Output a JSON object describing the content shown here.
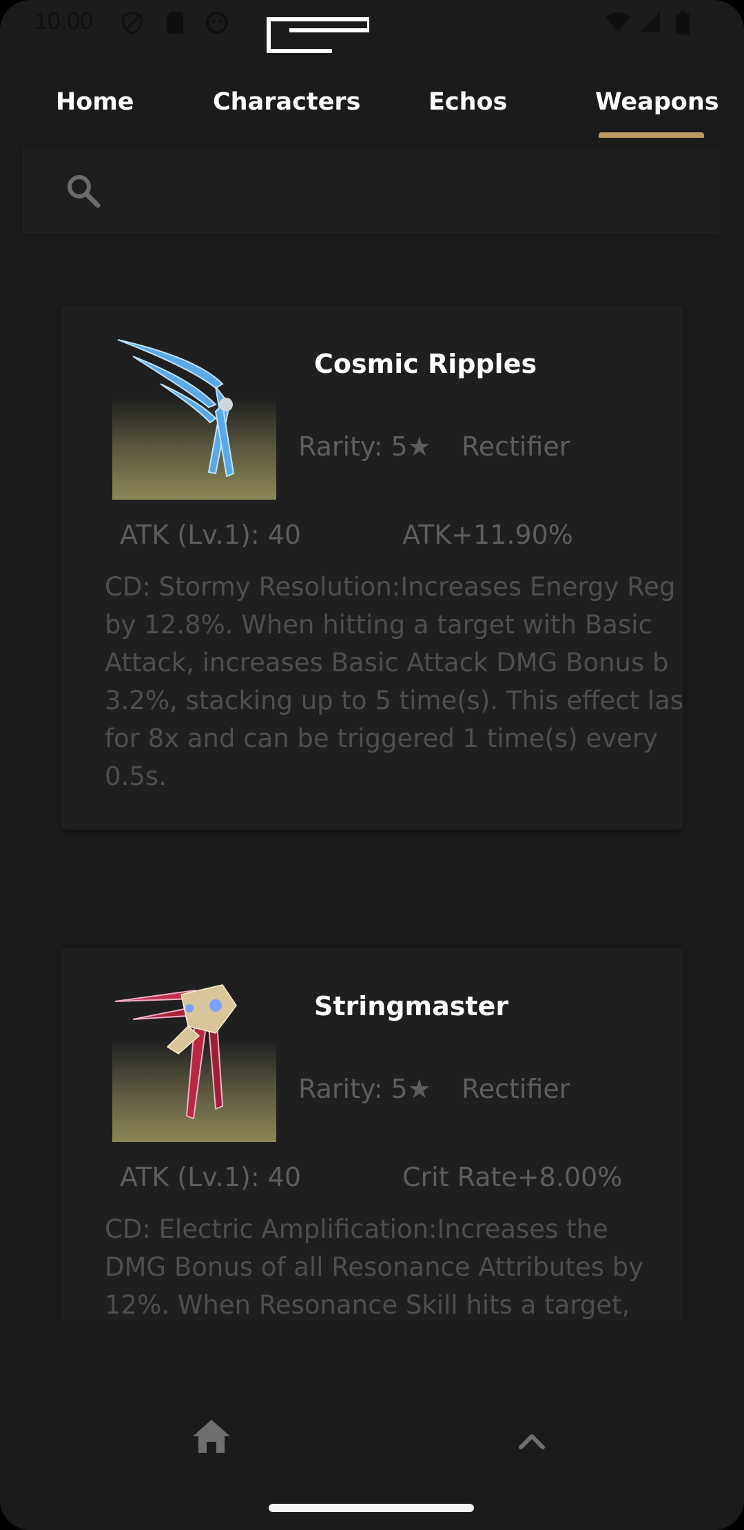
{
  "status_bar": {
    "time": "10:00",
    "icons": [
      "shield-icon",
      "sd-card-icon",
      "face-icon",
      "wifi-icon",
      "signal-icon",
      "battery-icon"
    ]
  },
  "tabs": [
    {
      "label": "Home"
    },
    {
      "label": "Characters"
    },
    {
      "label": "Echos"
    },
    {
      "label": "Weapons",
      "selected": true
    }
  ],
  "search": {
    "placeholder": "",
    "value": ""
  },
  "weapons": [
    {
      "name": "Cosmic Ripples",
      "rarity": "Rarity: 5★",
      "type": "Rectifier",
      "atk": "ATK (Lv.1): 40",
      "substat": "ATK+11.90%",
      "description_lines": [
        "CD: Stormy Resolution:Increases Energy Reg",
        "by 12.8%. When hitting a target with Basic",
        "Attack, increases Basic Attack DMG Bonus b",
        "3.2%, stacking up to 5 time(s). This effect las",
        "for 8x and can be triggered 1 time(s) every",
        "0.5s."
      ]
    },
    {
      "name": "Stringmaster",
      "rarity": "Rarity: 5★",
      "type": "Rectifier",
      "atk": "ATK (Lv.1): 40",
      "substat": "Crit Rate+8.00%",
      "description_lines": [
        "CD: Electric Amplification:Increases the",
        "DMG Bonus of all Resonance Attributes by",
        "12%. When Resonance Skill hits a target,"
      ]
    }
  ],
  "bottom_bar": {
    "icons": [
      "home-icon",
      "chevron-up-icon"
    ]
  },
  "colors": {
    "background": "#1b1b1c",
    "accent": "#b89a62",
    "muted_text": "#5e5e5e"
  }
}
